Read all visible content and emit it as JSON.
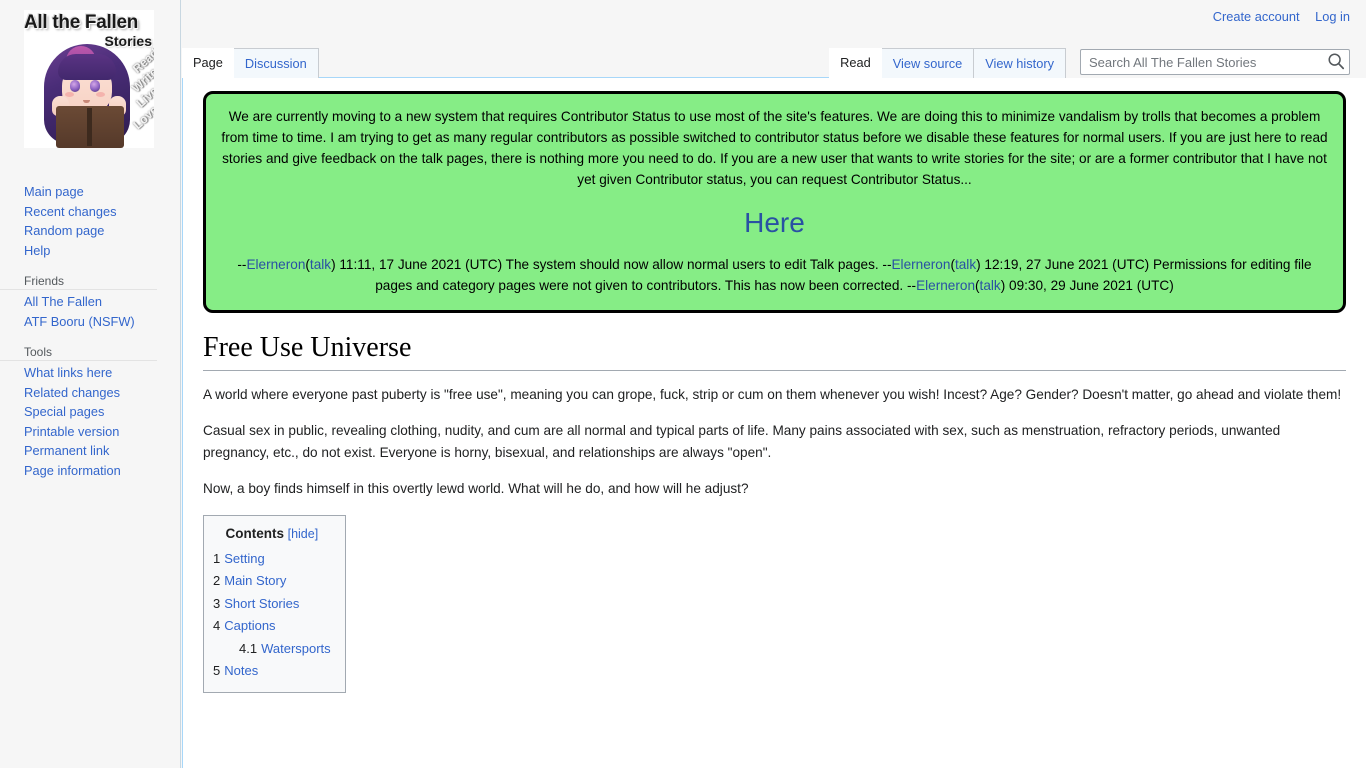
{
  "site": {
    "logo_title": "All the Fallen",
    "logo_subtitle": "Stories",
    "logo_diagonal_words": [
      "Read",
      "Write",
      "Live",
      "Love"
    ]
  },
  "personal": {
    "create_account": "Create account",
    "log_in": "Log in"
  },
  "namespace_tabs": [
    {
      "label": "Page",
      "selected": true
    },
    {
      "label": "Discussion",
      "selected": false
    }
  ],
  "view_tabs": [
    {
      "label": "Read",
      "selected": true
    },
    {
      "label": "View source",
      "selected": false
    },
    {
      "label": "View history",
      "selected": false
    }
  ],
  "search": {
    "placeholder": "Search All The Fallen Stories",
    "value": "",
    "icon": "search-icon"
  },
  "sidebar": {
    "portlets": [
      {
        "heading": "",
        "items": [
          {
            "label": "Main page"
          },
          {
            "label": "Recent changes"
          },
          {
            "label": "Random page"
          },
          {
            "label": "Help"
          }
        ]
      },
      {
        "heading": "Friends",
        "items": [
          {
            "label": "All The Fallen"
          },
          {
            "label": "ATF Booru (NSFW)"
          }
        ]
      },
      {
        "heading": "Tools",
        "items": [
          {
            "label": "What links here"
          },
          {
            "label": "Related changes"
          },
          {
            "label": "Special pages"
          },
          {
            "label": "Printable version"
          },
          {
            "label": "Permanent link"
          },
          {
            "label": "Page information"
          }
        ]
      }
    ]
  },
  "sitenotice": {
    "paragraph": "We are currently moving to a new system that requires Contributor Status to use most of the site's features. We are doing this to minimize vandalism by trolls that becomes a problem from time to time. I am trying to get as many regular contributors as possible switched to contributor status before we disable these features for normal users. If you are just here to read stories and give feedback on the talk pages, there is nothing more you need to do. If you are a new user that wants to write stories for the site; or are a former contributor that I have not yet given Contributor status, you can request Contributor Status...",
    "here_link": "Here",
    "signatures": {
      "dashes": "--",
      "user": "Elerneron",
      "talk": "talk",
      "open_paren": "(",
      "close_paren": ")",
      "sig1_time": " 11:11, 17 June 2021 (UTC) ",
      "sig1_text": "The system should now allow normal users to edit Talk pages. ",
      "sig2_time": " 12:19, 27 June 2021 (UTC)",
      "sig2_text": "Permissions for editing file pages and category pages were not given to contributors. This has now been corrected. ",
      "sig3_time": " 09:30, 29 June 2021 (UTC)"
    },
    "background_color": "#86ed86",
    "border_color": "#000000",
    "link_color": "#2951a3"
  },
  "article": {
    "title": "Free Use Universe",
    "paragraphs": [
      "A world where everyone past puberty is \"free use\", meaning you can grope, fuck, strip or cum on them whenever you wish! Incest? Age? Gender? Doesn't matter, go ahead and violate them!",
      "Casual sex in public, revealing clothing, nudity, and cum are all normal and typical parts of life. Many pains associated with sex, such as menstruation, refractory periods, unwanted pregnancy, etc., do not exist. Everyone is horny, bisexual, and relationships are always \"open\".",
      "Now, a boy finds himself in this overtly lewd world. What will he do, and how will he adjust?"
    ]
  },
  "toc": {
    "title": "Contents",
    "toggle_open": "[",
    "toggle_label": "hide",
    "toggle_close": "]",
    "entries": [
      {
        "number": "1",
        "label": "Setting",
        "sub": []
      },
      {
        "number": "2",
        "label": "Main Story",
        "sub": []
      },
      {
        "number": "3",
        "label": "Short Stories",
        "sub": []
      },
      {
        "number": "4",
        "label": "Captions",
        "sub": [
          {
            "number": "4.1",
            "label": "Watersports"
          }
        ]
      },
      {
        "number": "5",
        "label": "Notes",
        "sub": []
      }
    ]
  },
  "theme": {
    "link_color": "#3366cc",
    "sidebar_bg": "#f6f6f6",
    "content_bg": "#ffffff",
    "tab_inactive_bg": "#f3f8fc"
  }
}
